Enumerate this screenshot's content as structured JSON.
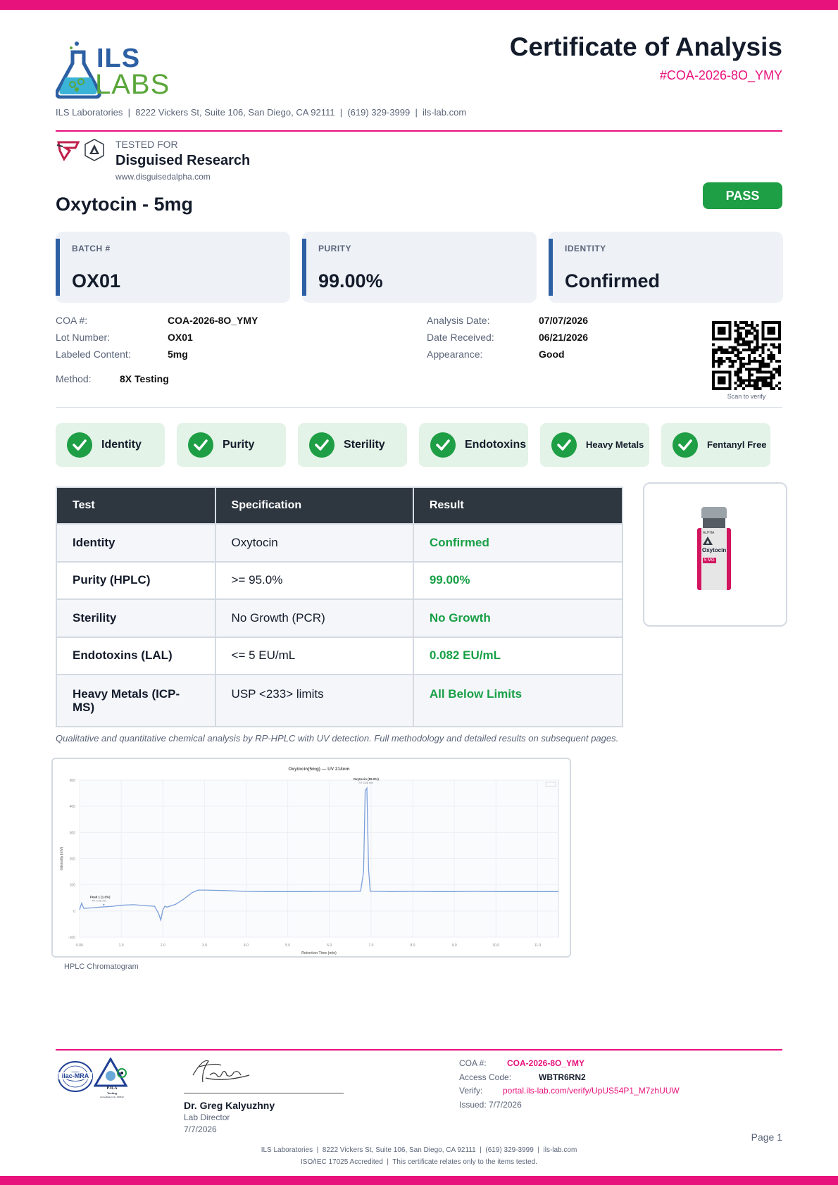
{
  "header": {
    "logo_top": "ILS",
    "logo_bottom": "LABS",
    "title": "Certificate of Analysis",
    "coa_ref": "#COA-2026-8O_YMY",
    "address_line": "ILS Laboratories  |  8222 Vickers St, Suite 106, San Diego, CA 92111  |  (619) 329-3999  |  ils-lab.com"
  },
  "client": {
    "tested_for_label": "TESTED FOR",
    "name": "Disguised Research",
    "website": "www.disguisedalpha.com"
  },
  "product": {
    "name": "Oxytocin - 5mg",
    "status": "PASS"
  },
  "cards": [
    {
      "label": "BATCH #",
      "value": "OX01"
    },
    {
      "label": "PURITY",
      "value": "99.00%"
    },
    {
      "label": "IDENTITY",
      "value": "Confirmed"
    }
  ],
  "info_left": [
    {
      "key": "COA #:",
      "value": "COA-2026-8O_YMY"
    },
    {
      "key": "Lot Number:",
      "value": "OX01"
    },
    {
      "key": "Labeled Content:",
      "value": "5mg"
    }
  ],
  "method": {
    "key": "Method:",
    "value": "8X Testing"
  },
  "info_right": [
    {
      "key": "Analysis Date:",
      "value": "07/07/2026"
    },
    {
      "key": "Date Received:",
      "value": "06/21/2026"
    },
    {
      "key": "Appearance:",
      "value": "Good"
    }
  ],
  "qr_caption": "Scan to verify",
  "badges": [
    "Identity",
    "Purity",
    "Sterility",
    "Endotoxins",
    "Heavy Metals",
    "Fentanyl Free"
  ],
  "results_table": {
    "headers": [
      "Test",
      "Specification",
      "Result"
    ],
    "rows": [
      {
        "test": "Identity",
        "spec": "Oxytocin",
        "result": "Confirmed"
      },
      {
        "test": "Purity (HPLC)",
        "spec": ">= 95.0%",
        "result": "99.00%"
      },
      {
        "test": "Sterility",
        "spec": "No Growth (PCR)",
        "result": "No Growth"
      },
      {
        "test": "Endotoxins (LAL)",
        "spec": "<= 5 EU/mL",
        "result": "0.082 EU/mL"
      },
      {
        "test": "Heavy Metals (ICP-MS)",
        "spec": "USP <233> limits",
        "result": "All Below Limits"
      }
    ]
  },
  "vial": {
    "brand": "ALPHA",
    "name": "Oxytocin",
    "dose": "5 MG"
  },
  "method_note": "Qualitative and quantitative chemical analysis by RP-HPLC with UV detection. Full methodology and detailed results on subsequent pages.",
  "chart_caption": "HPLC Chromatogram",
  "chart_data": {
    "type": "line",
    "title": "Oxytocin(5mg) — UV 214nm",
    "xlabel": "Retention Time (min)",
    "ylabel": "Intensity (mV)",
    "xlim": [
      0,
      11.5
    ],
    "ylim": [
      -100,
      500
    ],
    "x_ticks": [
      "0.00",
      "1.0",
      "2.0",
      "3.0",
      "4.0",
      "5.0",
      "6.0",
      "7.0",
      "8.0",
      "9.0",
      "10.0",
      "11.0"
    ],
    "y_ticks": [
      "-100",
      "0",
      "100",
      "200",
      "300",
      "400",
      "500"
    ],
    "grid": true,
    "series": [
      {
        "x": [
          0,
          0.05,
          0.1,
          0.3,
          0.5,
          0.8,
          1.0,
          1.3,
          1.6,
          1.8,
          1.9,
          1.95,
          2.0,
          2.05,
          2.1,
          2.3,
          2.5,
          2.7,
          2.85,
          3.0,
          3.5,
          4.0,
          4.5,
          5.0,
          5.5,
          6.0,
          6.5,
          6.75,
          6.82,
          6.86,
          6.9,
          6.94,
          6.98,
          7.05,
          7.2,
          7.5,
          8.0,
          8.5,
          9.0,
          9.5,
          10.0,
          10.5,
          11.0,
          11.5
        ],
        "y": [
          5,
          30,
          10,
          12,
          15,
          18,
          22,
          24,
          20,
          18,
          -10,
          -35,
          5,
          18,
          15,
          25,
          45,
          70,
          80,
          80,
          78,
          75,
          74,
          74,
          74,
          75,
          75,
          76,
          150,
          460,
          470,
          160,
          76,
          75,
          75,
          74,
          75,
          74,
          74,
          75,
          74,
          74,
          74,
          74
        ]
      }
    ],
    "annotations": [
      {
        "label": "Peak 1 (1.0%)",
        "sub": "RT 0.58 min"
      },
      {
        "label": "Oxytocin (99.0%)",
        "sub": "RT 6.88 min"
      }
    ],
    "legend": "top-right"
  },
  "signature": {
    "name": "Dr. Greg Kalyuzhny",
    "role": "Lab Director",
    "date": "7/7/2026"
  },
  "accreditation": {
    "ilac": "ilac-MRA",
    "pjla": "PJLA",
    "pjla_sub": "Testing",
    "pjla_acc": "Accreditation No. 109612"
  },
  "footer_info": [
    {
      "key": "COA #:",
      "value": "COA-2026-8O_YMY"
    },
    {
      "key": "Access Code:",
      "value": "WBTR6RN2"
    },
    {
      "key": "Verify:",
      "value": "portal.ils-lab.com/verify/UpUS54P1_M7zhUUW"
    },
    {
      "key": "Issued:",
      "value": "7/7/2026"
    }
  ],
  "page_label": "Page 1",
  "footer_line1": "ILS Laboratories  |  8222 Vickers St, Suite 106, San Diego, CA 92111  |  (619) 329-3999  |  ils-lab.com",
  "footer_line2": "ISO/IEC 17025 Accredited  |  This certificate relates only to the items tested.",
  "colors": {
    "accent": "#e8127c",
    "brand_blue": "#2d5fa3",
    "pass_green": "#1e9e45",
    "logo_green": "#5aa63a",
    "logo_blue": "#2d5fa3"
  }
}
